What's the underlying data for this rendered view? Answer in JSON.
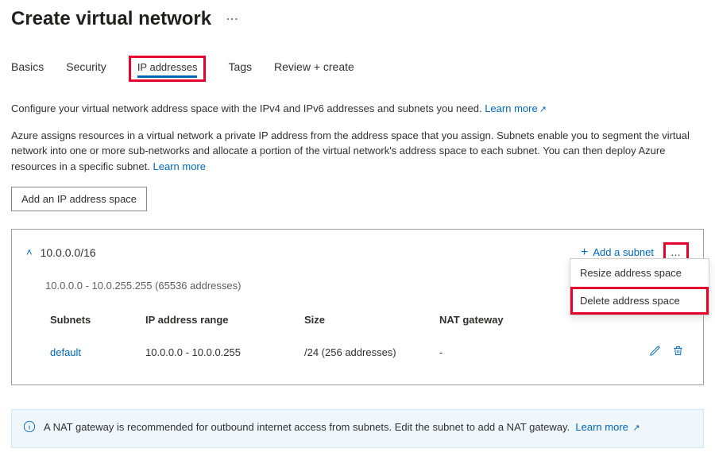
{
  "header": {
    "title": "Create virtual network"
  },
  "tabs": {
    "basics": "Basics",
    "security": "Security",
    "ip": "IP addresses",
    "tags": "Tags",
    "review": "Review + create"
  },
  "intro": {
    "line1": "Configure your virtual network address space with the IPv4 and IPv6 addresses and subnets you need.",
    "learn1": "Learn more",
    "line2": "Azure assigns resources in a virtual network a private IP address from the address space that you assign. Subnets enable you to segment the virtual network into one or more sub-networks and allocate a portion of the virtual network's address space to each subnet. You can then deploy Azure resources in a specific subnet.",
    "learn2": "Learn more"
  },
  "buttons": {
    "add_space": "Add an IP address space",
    "add_subnet": "Add a subnet"
  },
  "space": {
    "cidr": "10.0.0.0/16",
    "range_desc": "10.0.0.0 - 10.0.255.255 (65536 addresses)"
  },
  "table": {
    "col_subnets": "Subnets",
    "col_range": "IP address range",
    "col_size": "Size",
    "col_nat": "NAT gateway"
  },
  "row": {
    "name": "default",
    "range": "10.0.0.0 - 10.0.0.255",
    "size": "/24 (256 addresses)",
    "nat": "-"
  },
  "menu": {
    "resize": "Resize address space",
    "delete": "Delete address space"
  },
  "banner": {
    "text": "A NAT gateway is recommended for outbound internet access from subnets. Edit the subnet to add a NAT gateway.",
    "learn": "Learn more"
  }
}
